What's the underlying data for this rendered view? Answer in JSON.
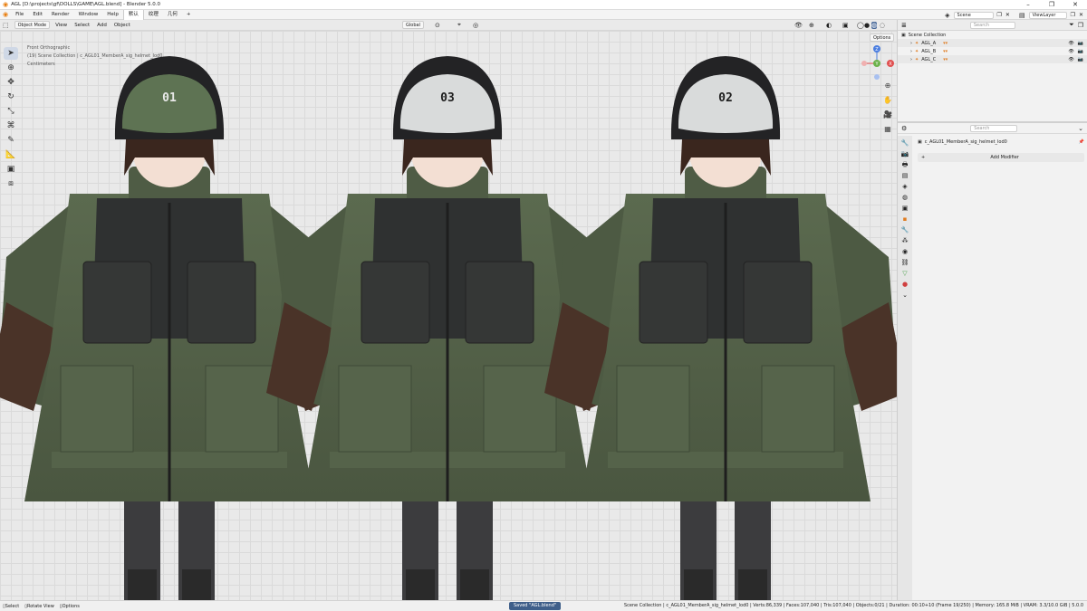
{
  "window": {
    "title": "AGL [D:\\projects\\gf\\DOLLS\\GAME\\AGL.blend] - Blender 5.0.0",
    "controls": [
      "–",
      "❐",
      "✕"
    ]
  },
  "menubar": {
    "items": [
      "File",
      "Edit",
      "Render",
      "Window",
      "Help"
    ],
    "workspaces": [
      "默认",
      "纹理",
      "几何"
    ],
    "add_workspace": "+",
    "scene": "Scene",
    "view_layer": "ViewLayer"
  },
  "viewport_header": {
    "mode": "Object Mode",
    "menus": [
      "View",
      "Select",
      "Add",
      "Object"
    ],
    "orientation": "Global",
    "options": "Options"
  },
  "overlay": {
    "view": "Front Orthographic",
    "collection": "(19) Scene Collection | c_AGL01_MemberA_sig_helmet_lod0",
    "units": "Centimeters"
  },
  "gizmo": {
    "z": "Z",
    "y": "Y",
    "x": "X"
  },
  "characters": [
    {
      "helmet_label": "01"
    },
    {
      "helmet_label": "03"
    },
    {
      "helmet_label": "02"
    }
  ],
  "outliner": {
    "search_placeholder": "Search",
    "root": "Scene Collection",
    "rows": [
      {
        "label": "AGL_A"
      },
      {
        "label": "AGL_B"
      },
      {
        "label": "AGL_C"
      }
    ]
  },
  "properties": {
    "search_placeholder": "Search",
    "object": "c_AGL01_MemberA_sig_helmet_lod0",
    "add_modifier": "Add Modifier"
  },
  "statusbar": {
    "select": "Select",
    "rotate": "Rotate View",
    "options": "Options",
    "saved": "Saved \"AGL.blend\"",
    "stats": "Scene Collection | c_AGL01_MemberA_sig_helmet_lod0 | Verts:86,339 | Faces:107,040 | Tris:107,040 | Objects:0/21 | Duration: 00:10+10 (Frame 19/250) | Memory: 165.8 MiB | VRAM: 3.3/10.0 GiB | 5.0.0"
  }
}
